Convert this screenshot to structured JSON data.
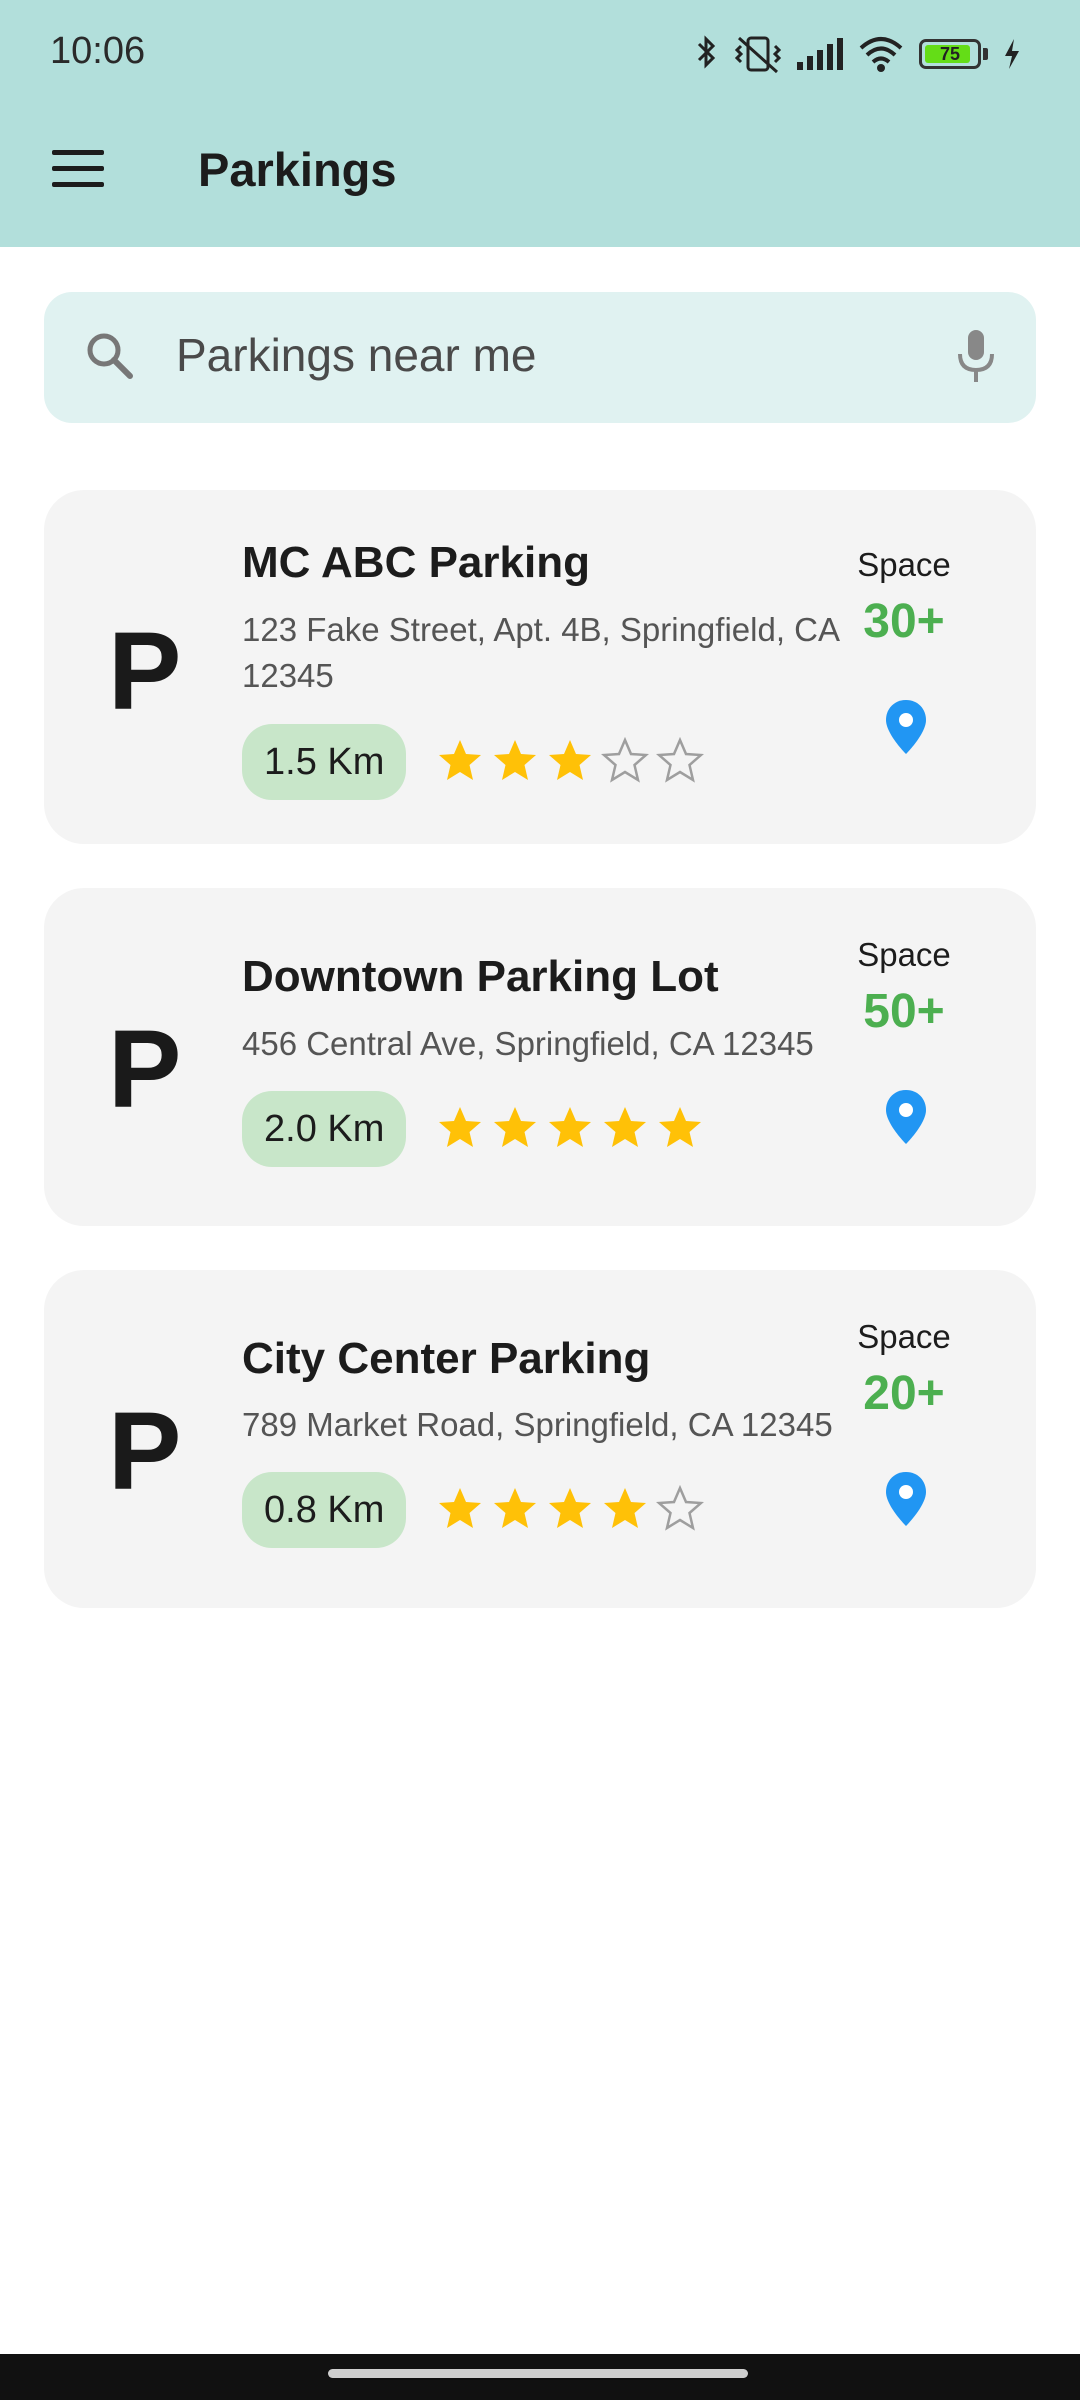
{
  "status_bar": {
    "time": "10:06",
    "battery": "75"
  },
  "header": {
    "title": "Parkings"
  },
  "search": {
    "placeholder": "Parkings near me"
  },
  "parkings": [
    {
      "icon_letter": "P",
      "name": "MC ABC Parking",
      "address": "123 Fake Street, Apt. 4B, Springfield, CA 12345",
      "distance": "1.5 Km",
      "rating": 3,
      "space_label": "Space",
      "space": "30+"
    },
    {
      "icon_letter": "P",
      "name": "Downtown Parking Lot",
      "address": "456 Central Ave, Springfield, CA 12345",
      "distance": "2.0 Km",
      "rating": 5,
      "space_label": "Space",
      "space": "50+"
    },
    {
      "icon_letter": "P",
      "name": "City Center Parking",
      "address": "789 Market Road, Springfield, CA 12345",
      "distance": "0.8 Km",
      "rating": 4,
      "space_label": "Space",
      "space": "20+"
    }
  ],
  "colors": {
    "appbar": "#b2dfdb",
    "search_bg": "#e0f2f1",
    "card_bg": "#f4f4f4",
    "distance_chip": "#c8e6c9",
    "space_green": "#4caf50",
    "star": "#ffc107",
    "pin": "#2196f3"
  },
  "icons": [
    "menu-icon",
    "search-icon",
    "mic-icon",
    "star-icon",
    "location-pin-icon",
    "bluetooth-icon",
    "vibrate-icon",
    "signal-icon",
    "wifi-icon",
    "battery-icon"
  ]
}
